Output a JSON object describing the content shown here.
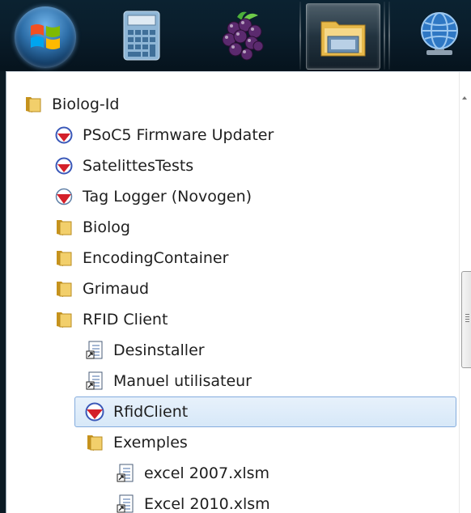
{
  "taskbar": {
    "buttons": [
      {
        "name": "start-orb-icon"
      },
      {
        "name": "calculator-icon"
      },
      {
        "name": "raspberry-icon"
      },
      {
        "name": "file-explorer-icon",
        "active": true
      },
      {
        "name": "network-globe-icon"
      }
    ]
  },
  "menu": {
    "items": [
      {
        "label": "Biolog-Id",
        "icon": "folder-icon",
        "level": 0
      },
      {
        "label": "PSoC5 Firmware Updater",
        "icon": "app-arrow-icon",
        "level": 1
      },
      {
        "label": "SatelittesTests",
        "icon": "app-arrow-icon",
        "level": 1
      },
      {
        "label": "Tag Logger (Novogen)",
        "icon": "app-arrow-icon",
        "level": 1
      },
      {
        "label": "Biolog",
        "icon": "folder-icon",
        "level": 1
      },
      {
        "label": "EncodingContainer",
        "icon": "folder-icon",
        "level": 1
      },
      {
        "label": "Grimaud",
        "icon": "folder-icon",
        "level": 1
      },
      {
        "label": "RFID Client",
        "icon": "folder-icon",
        "level": 1
      },
      {
        "label": "Desinstaller",
        "icon": "shortcut-document-icon",
        "level": 2
      },
      {
        "label": "Manuel utilisateur",
        "icon": "shortcut-document-icon",
        "level": 2
      },
      {
        "label": "RfidClient",
        "icon": "app-arrow-icon",
        "level": 2,
        "selected": true
      },
      {
        "label": "Exemples",
        "icon": "folder-icon",
        "level": 2
      },
      {
        "label": "excel 2007.xlsm",
        "icon": "shortcut-document-icon",
        "level": 3
      },
      {
        "label": "Excel 2010.xlsm",
        "icon": "shortcut-document-icon",
        "level": 3
      }
    ]
  },
  "colors": {
    "selection_border": "#84acdd",
    "selection_fill": "#dbe9f8",
    "folder": "#e8c15a",
    "app_red": "#d4202a"
  }
}
